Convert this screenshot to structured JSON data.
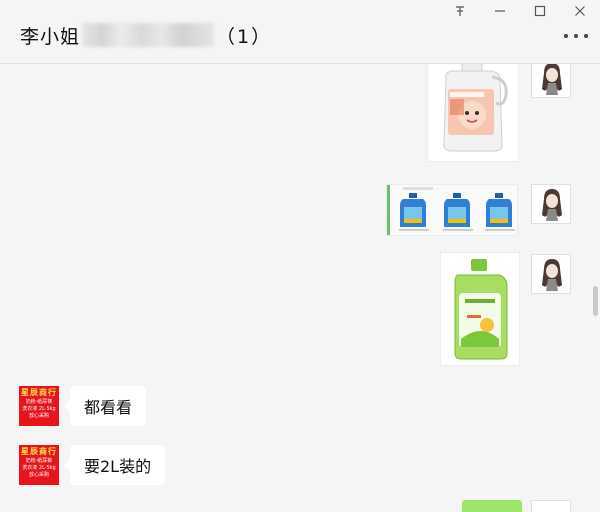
{
  "header": {
    "contact_name": "李小姐",
    "member_count": "（1）",
    "more_icon": "ellipsis-icon"
  },
  "window_controls": {
    "pin_icon": "pin-icon",
    "minimize_icon": "minimize-icon",
    "maximize_icon": "maximize-icon",
    "close_icon": "close-icon"
  },
  "messages": [
    {
      "sender": "self",
      "type": "image",
      "content": "baby-detergent-bottle"
    },
    {
      "sender": "self",
      "type": "image",
      "content": "three-blue-detergent-bottles"
    },
    {
      "sender": "self",
      "type": "image",
      "content": "green-detergent-bottle"
    },
    {
      "sender": "other",
      "type": "text",
      "text": "都看看"
    },
    {
      "sender": "other",
      "type": "text",
      "text": "要2L装的"
    }
  ],
  "shop_avatar": {
    "title": "星辰商行",
    "lines": [
      "奶粉·纸尿裤",
      "洗衣液 2L·5kg",
      "放心采购"
    ]
  },
  "colors": {
    "background": "#f5f5f5",
    "bubble": "#ffffff",
    "shop_avatar": "#e8141b",
    "self_bubble": "#9de46a"
  }
}
